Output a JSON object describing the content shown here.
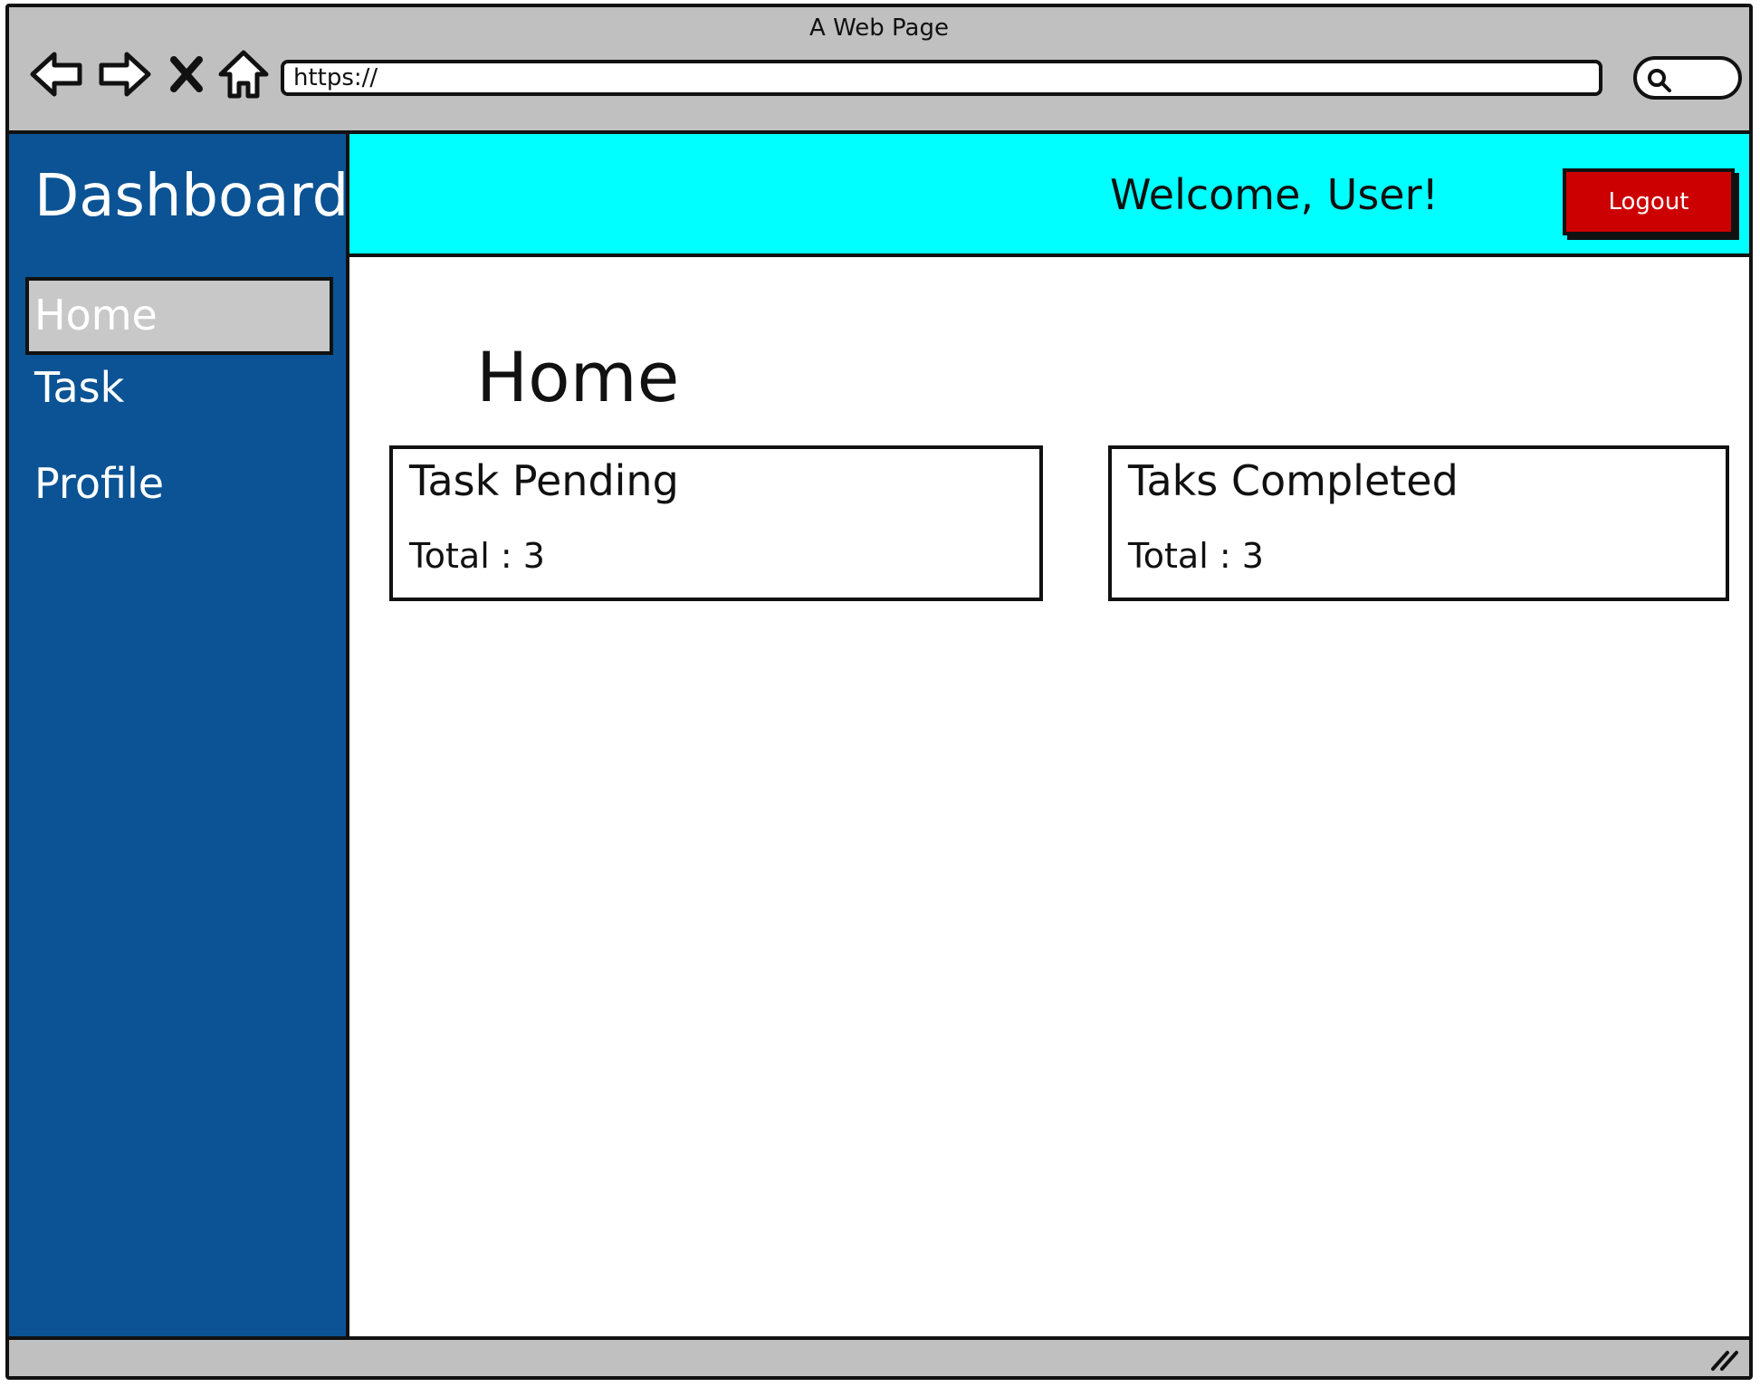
{
  "browser": {
    "title": "A Web Page",
    "url": "https://",
    "icons": [
      "back-arrow-icon",
      "forward-arrow-icon",
      "close-icon",
      "home-icon",
      "search-icon",
      "resize-handle-icon"
    ]
  },
  "sidebar": {
    "title": "Dashboard",
    "items": [
      {
        "label": "Home",
        "active": true
      },
      {
        "label": "Task",
        "active": false
      },
      {
        "label": "Profile",
        "active": false
      }
    ]
  },
  "header": {
    "welcome": "Welcome, User!",
    "logout_label": "Logout"
  },
  "main": {
    "title": "Home",
    "cards": [
      {
        "title": "Task Pending",
        "total": "Total : 3"
      },
      {
        "title": "Taks Completed",
        "total": "Total : 3"
      }
    ]
  },
  "colors": {
    "sidebar": "#0b5394",
    "header": "#00ffff",
    "logout": "#cc0000",
    "active_item": "#c8c8c8",
    "chrome": "#c0c0c0"
  }
}
